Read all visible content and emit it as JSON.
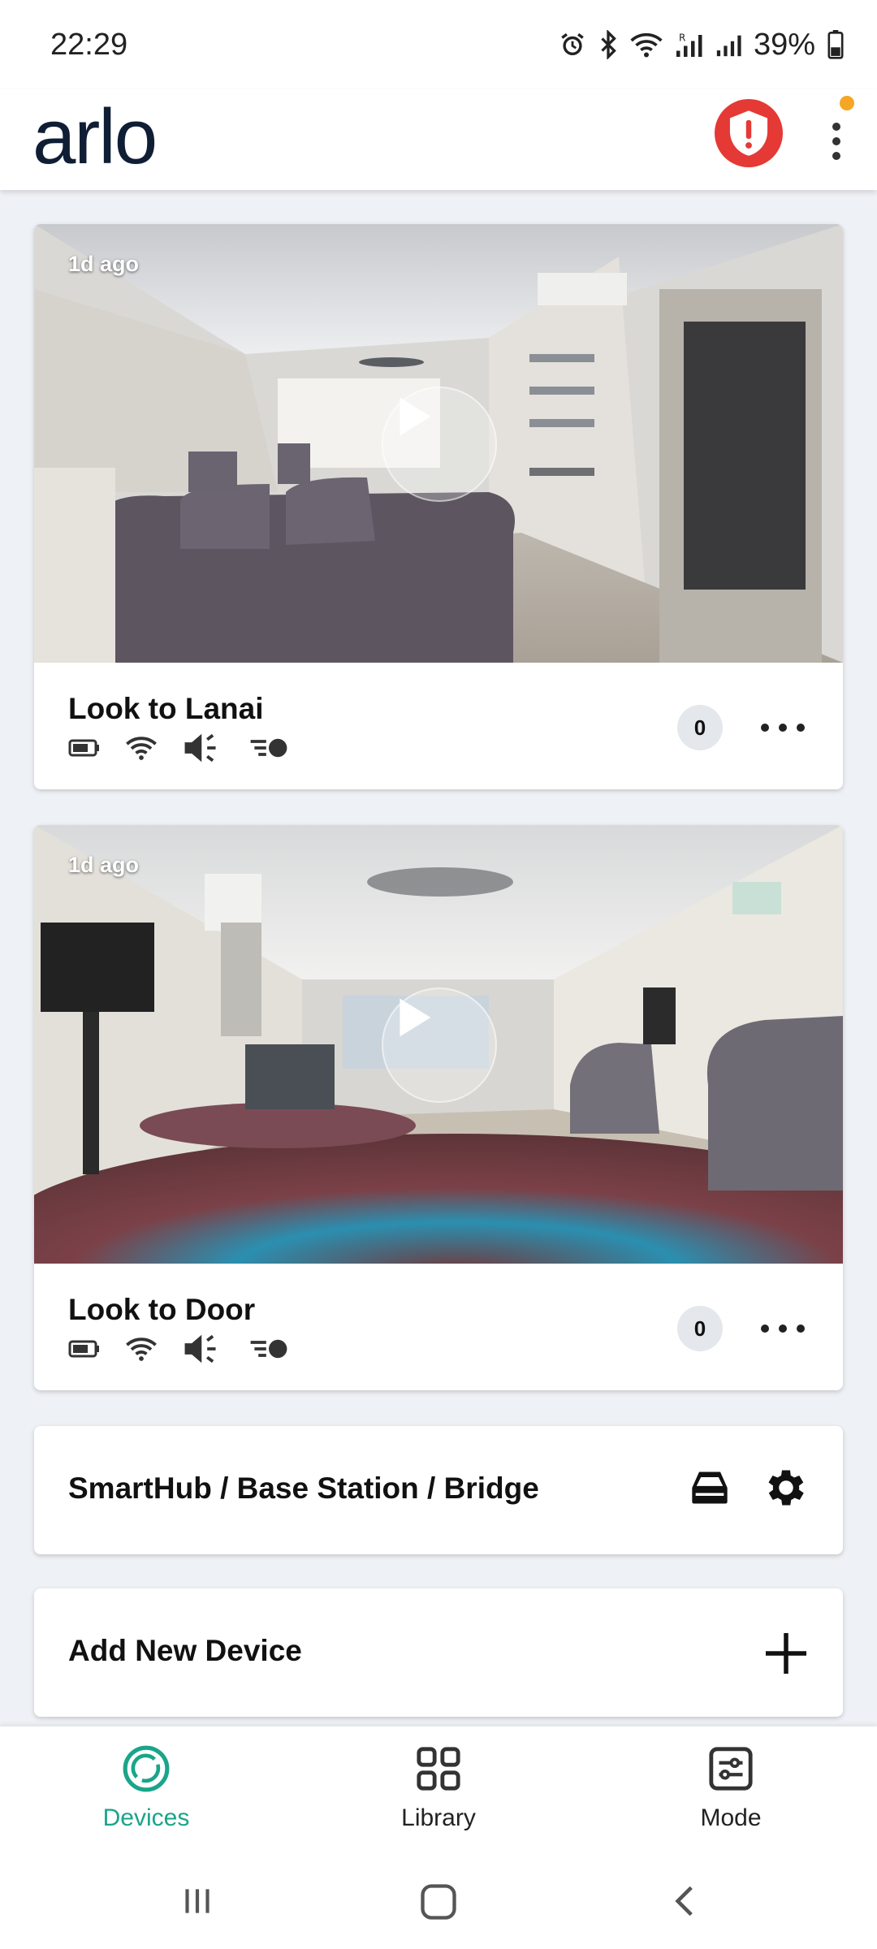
{
  "status_bar": {
    "time": "22:29",
    "battery_percent": "39%",
    "icons": [
      "alarm-icon",
      "bluetooth-icon",
      "wifi-icon",
      "signal-r-icon",
      "signal-icon",
      "battery-icon"
    ]
  },
  "header": {
    "logo": "arlo",
    "alert_color": "#e53935",
    "notification_dot_color": "#f5a623"
  },
  "cameras": [
    {
      "name": "Look to Lanai",
      "timestamp": "1d ago",
      "count": "0",
      "status_icons": [
        "battery-icon",
        "wifi-icon",
        "speaker-icon",
        "motion-icon"
      ]
    },
    {
      "name": "Look to Door",
      "timestamp": "1d ago",
      "count": "0",
      "status_icons": [
        "battery-icon",
        "wifi-icon",
        "speaker-icon",
        "motion-icon"
      ]
    }
  ],
  "smarthub": {
    "label": "SmartHub / Base Station / Bridge"
  },
  "add_device": {
    "label": "Add New Device"
  },
  "bottom_nav": {
    "items": [
      {
        "label": "Devices",
        "icon": "devices-icon",
        "active": true
      },
      {
        "label": "Library",
        "icon": "grid-icon",
        "active": false
      },
      {
        "label": "Mode",
        "icon": "sliders-icon",
        "active": false
      }
    ],
    "active_color": "#1aa58a"
  }
}
